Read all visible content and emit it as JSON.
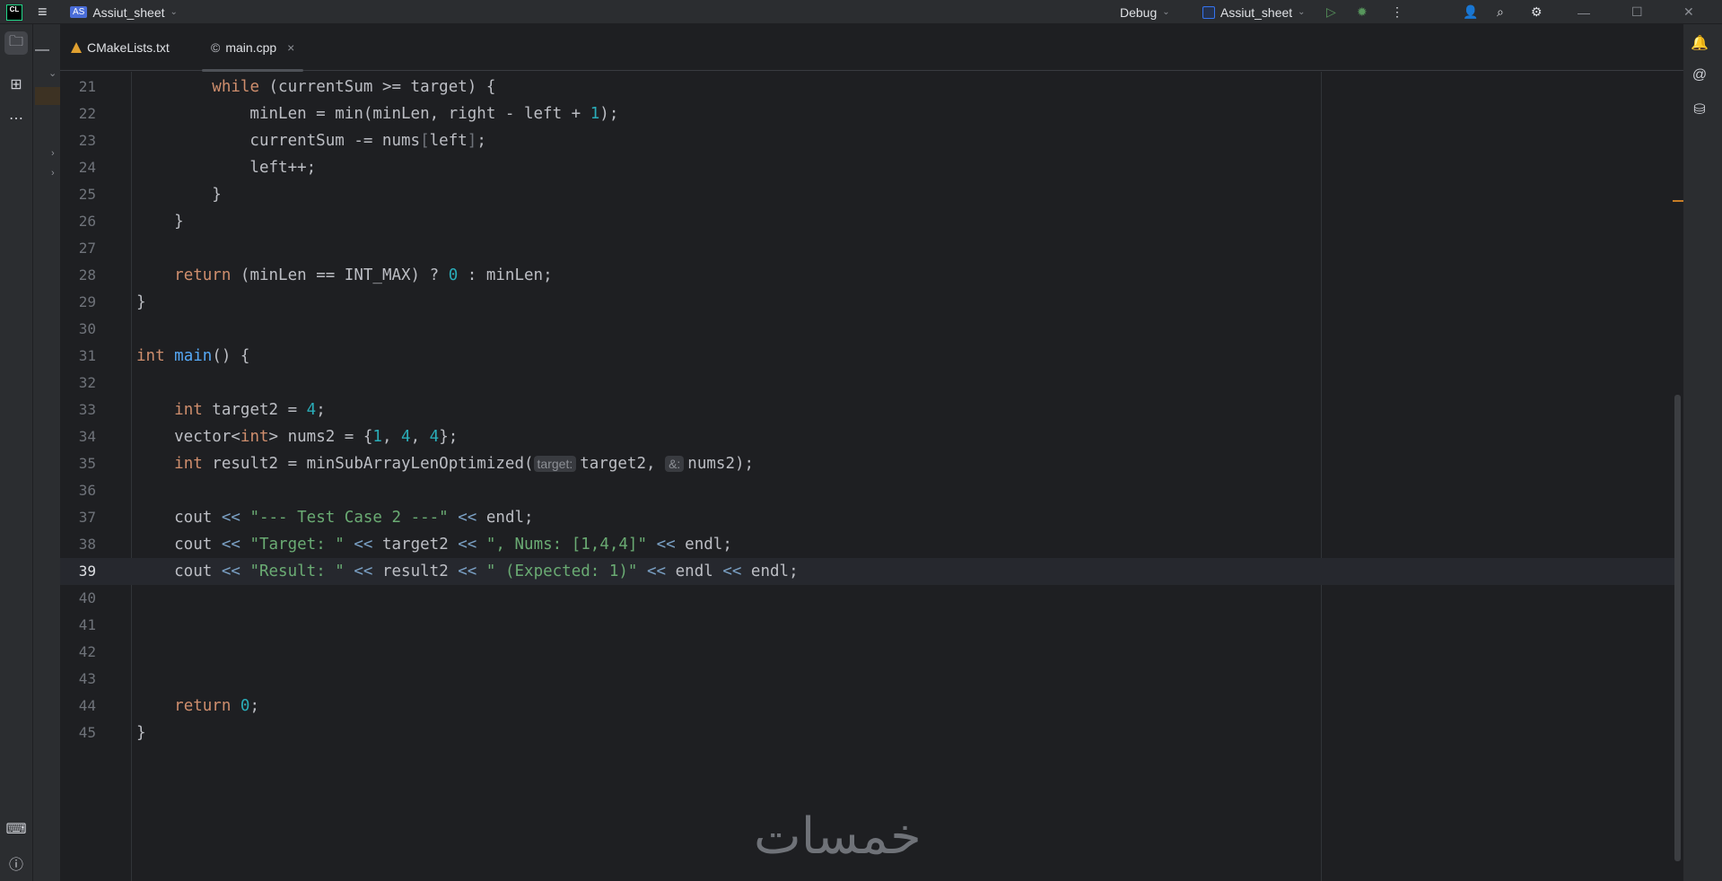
{
  "titlebar": {
    "project_badge": "AS",
    "project": "Assiut_sheet",
    "config": "Debug",
    "run_target": "Assiut_sheet"
  },
  "tabs": [
    {
      "label": "CMakeLists.txt"
    },
    {
      "label": "main.cpp",
      "close": "×"
    }
  ],
  "watermark": "خمسات",
  "colors": {
    "keyword": "#cf8e6d",
    "number": "#2aacb8",
    "string": "#6aab73",
    "function": "#56a8f5"
  },
  "current_line": 39,
  "lines": [
    {
      "n": "21",
      "t": [
        [
          "",
          "        "
        ],
        [
          "k",
          "while"
        ],
        [
          "",
          " (currentSum >= target) {"
        ]
      ]
    },
    {
      "n": "22",
      "t": [
        [
          "",
          "            minLen = min(minLen, right - left + "
        ],
        [
          "n",
          "1"
        ],
        [
          "",
          ");"
        ]
      ]
    },
    {
      "n": "23",
      "t": [
        [
          "",
          "            currentSum -= nums"
        ],
        [
          "d",
          "["
        ],
        [
          "",
          "left"
        ],
        [
          "d",
          "]"
        ],
        [
          "",
          ";"
        ]
      ]
    },
    {
      "n": "24",
      "t": [
        [
          "",
          "            left++;"
        ]
      ]
    },
    {
      "n": "25",
      "t": [
        [
          "",
          "        }"
        ]
      ]
    },
    {
      "n": "26",
      "t": [
        [
          "",
          "    }"
        ]
      ]
    },
    {
      "n": "27",
      "t": []
    },
    {
      "n": "28",
      "t": [
        [
          "",
          "    "
        ],
        [
          "k",
          "return"
        ],
        [
          "",
          " (minLen == INT_MAX) ? "
        ],
        [
          "n",
          "0"
        ],
        [
          "",
          " : minLen;"
        ]
      ]
    },
    {
      "n": "29",
      "t": [
        [
          "",
          "}"
        ]
      ]
    },
    {
      "n": "30",
      "t": []
    },
    {
      "n": "31",
      "t": [
        [
          "k",
          "int"
        ],
        [
          "",
          " "
        ],
        [
          "f",
          "main"
        ],
        [
          "",
          "() {"
        ]
      ]
    },
    {
      "n": "32",
      "t": []
    },
    {
      "n": "33",
      "t": [
        [
          "",
          "    "
        ],
        [
          "k",
          "int"
        ],
        [
          "",
          " target2 = "
        ],
        [
          "n",
          "4"
        ],
        [
          "",
          ";"
        ]
      ]
    },
    {
      "n": "34",
      "t": [
        [
          "",
          "    vector<"
        ],
        [
          "k",
          "int"
        ],
        [
          "",
          "> nums2 = {"
        ],
        [
          "n",
          "1"
        ],
        [
          "",
          ", "
        ],
        [
          "n",
          "4"
        ],
        [
          "",
          ", "
        ],
        [
          "n",
          "4"
        ],
        [
          "",
          "};"
        ]
      ]
    },
    {
      "n": "35",
      "t": [
        [
          "",
          "    "
        ],
        [
          "k",
          "int"
        ],
        [
          "",
          " result2 = minSubArrayLenOptimized("
        ],
        [
          "hint",
          "target:"
        ],
        [
          "",
          "target2, "
        ],
        [
          "hint",
          "&:"
        ],
        [
          "",
          "nums2);"
        ]
      ]
    },
    {
      "n": "36",
      "t": []
    },
    {
      "n": "37",
      "t": [
        [
          "",
          "    cout "
        ],
        [
          "o",
          "<<"
        ],
        [
          "",
          " "
        ],
        [
          "s",
          "\"--- Test Case 2 ---\""
        ],
        [
          "",
          " "
        ],
        [
          "o",
          "<<"
        ],
        [
          "",
          " endl;"
        ]
      ]
    },
    {
      "n": "38",
      "t": [
        [
          "",
          "    cout "
        ],
        [
          "o",
          "<<"
        ],
        [
          "",
          " "
        ],
        [
          "s",
          "\"Target: \""
        ],
        [
          "",
          " "
        ],
        [
          "o",
          "<<"
        ],
        [
          "",
          " target2 "
        ],
        [
          "o",
          "<<"
        ],
        [
          "",
          " "
        ],
        [
          "s",
          "\", Nums: [1,4,4]\""
        ],
        [
          "",
          " "
        ],
        [
          "o",
          "<<"
        ],
        [
          "",
          " endl;"
        ]
      ]
    },
    {
      "n": "39",
      "t": [
        [
          "",
          "    cout "
        ],
        [
          "o",
          "<<"
        ],
        [
          "",
          " "
        ],
        [
          "s",
          "\"Result: \""
        ],
        [
          "",
          " "
        ],
        [
          "o",
          "<<"
        ],
        [
          "",
          " result2 "
        ],
        [
          "o",
          "<<"
        ],
        [
          "",
          " "
        ],
        [
          "s",
          "\" (Expected: 1)\""
        ],
        [
          "",
          " "
        ],
        [
          "o",
          "<<"
        ],
        [
          "",
          " endl "
        ],
        [
          "o",
          "<<"
        ],
        [
          "",
          " endl;"
        ]
      ]
    },
    {
      "n": "40",
      "t": []
    },
    {
      "n": "41",
      "t": []
    },
    {
      "n": "42",
      "t": []
    },
    {
      "n": "43",
      "t": []
    },
    {
      "n": "44",
      "t": [
        [
          "",
          "    "
        ],
        [
          "k",
          "return"
        ],
        [
          "",
          " "
        ],
        [
          "n",
          "0"
        ],
        [
          "",
          ";"
        ]
      ]
    },
    {
      "n": "45",
      "t": [
        [
          "",
          "}"
        ]
      ]
    }
  ]
}
